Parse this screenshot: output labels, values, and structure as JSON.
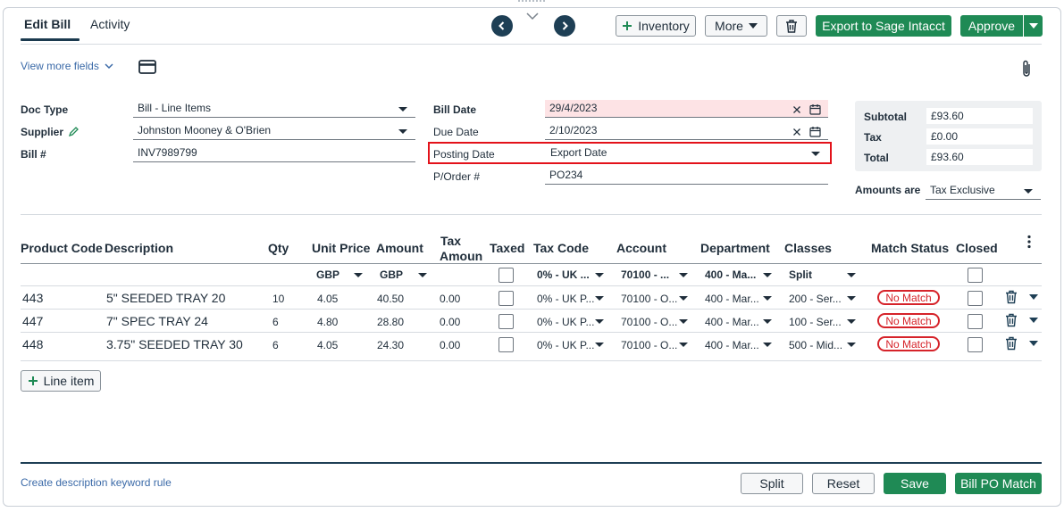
{
  "tabs": [
    {
      "label": "Edit Bill"
    },
    {
      "label": "Activity"
    }
  ],
  "toolbar": {
    "inventory_label": "Inventory",
    "more_label": "More",
    "export_label": "Export to Sage Intacct",
    "approve_label": "Approve"
  },
  "view_more_fields": "View more fields",
  "fields": {
    "doc_type": {
      "label": "Doc Type",
      "value": "Bill - Line Items"
    },
    "supplier": {
      "label": "Supplier",
      "value": "Johnston Mooney & O'Brien"
    },
    "bill_no": {
      "label": "Bill #",
      "value": "INV7989799"
    },
    "bill_date": {
      "label": "Bill Date",
      "value": "29/4/2023"
    },
    "due_date": {
      "label": "Due Date",
      "value": "2/10/2023"
    },
    "posting_date": {
      "label": "Posting Date",
      "value": "Export Date"
    },
    "po": {
      "label": "P/Order #",
      "value": "PO234"
    }
  },
  "totals": {
    "subtotal": {
      "label": "Subtotal",
      "value": "£93.60"
    },
    "tax": {
      "label": "Tax",
      "value": "£0.00"
    },
    "total": {
      "label": "Total",
      "value": "£93.60"
    },
    "amounts_are_label": "Amounts are",
    "amounts_are_value": "Tax Exclusive"
  },
  "table": {
    "headers": {
      "product_code": "Product Code",
      "description": "Description",
      "qty": "Qty",
      "unit_price": "Unit Price",
      "amount": "Amount",
      "tax_amount_1": "Tax",
      "tax_amount_2": "Amoun",
      "taxed": "Taxed",
      "tax_code": "Tax Code",
      "account": "Account",
      "department": "Department",
      "classes": "Classes",
      "match_status": "Match Status",
      "closed": "Closed"
    },
    "defaults": {
      "unit_price_currency": "GBP",
      "amount_currency": "GBP",
      "tax_code": "0% - UK ...",
      "account": "70100 - ...",
      "department": "400 - Ma...",
      "classes": "Split"
    },
    "rows": [
      {
        "code": "443",
        "description": "5\" SEEDED TRAY 20",
        "qty": "10",
        "unit_price": "4.05",
        "amount": "40.50",
        "tax": "0.00",
        "tax_code": "0% - UK P...",
        "account": "70100 - O...",
        "department": "400 - Mar...",
        "classes": "200 - Ser...",
        "match": "No Match"
      },
      {
        "code": "447",
        "description": "7\" SPEC TRAY 24",
        "qty": "6",
        "unit_price": "4.80",
        "amount": "28.80",
        "tax": "0.00",
        "tax_code": "0% - UK P...",
        "account": "70100 - O...",
        "department": "400 - Mar...",
        "classes": "100 - Ser...",
        "match": "No Match"
      },
      {
        "code": "448",
        "description": "3.75\" SEEDED TRAY 30",
        "qty": "6",
        "unit_price": "4.05",
        "amount": "24.30",
        "tax": "0.00",
        "tax_code": "0% - UK P...",
        "account": "70100 - O...",
        "department": "400 - Mar...",
        "classes": "500 - Mid...",
        "match": "No Match"
      }
    ]
  },
  "line_item_label": "Line item",
  "footer": {
    "keyword_rule": "Create description keyword rule",
    "split": "Split",
    "reset": "Reset",
    "save": "Save",
    "bill_po_match": "Bill PO Match"
  },
  "colors": {
    "accent_green": "#1f8a55",
    "navy": "#1e3f55",
    "error_red": "#d6232a"
  }
}
